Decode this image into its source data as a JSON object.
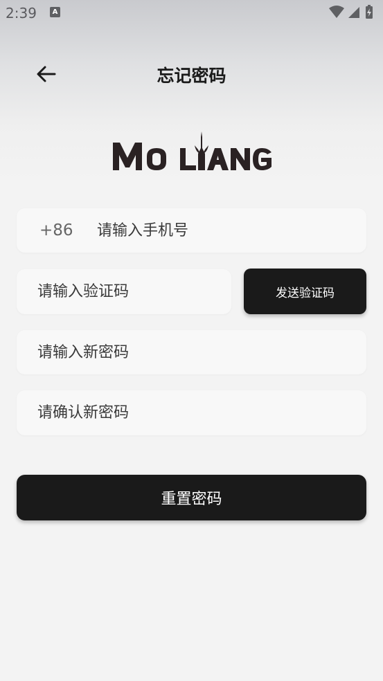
{
  "status_bar": {
    "time": "2:39",
    "notification_icon_letter": "A",
    "icons": [
      "wifi-icon",
      "signal-icon",
      "battery-charging-icon"
    ]
  },
  "header": {
    "title": "忘记密码",
    "back_icon": "arrow-left-icon"
  },
  "logo": {
    "text": "MO LIANG",
    "color": "#2a2223"
  },
  "form": {
    "country_code": "+86",
    "phone_placeholder": "请输入手机号",
    "code_placeholder": "请输入验证码",
    "send_code_label": "发送验证码",
    "new_password_placeholder": "请输入新密码",
    "confirm_password_placeholder": "请确认新密码",
    "submit_label": "重置密码"
  },
  "colors": {
    "primary_button": "#1a1a1a",
    "field_background": "#f8f8f8",
    "page_background": "#f3f3f3"
  }
}
